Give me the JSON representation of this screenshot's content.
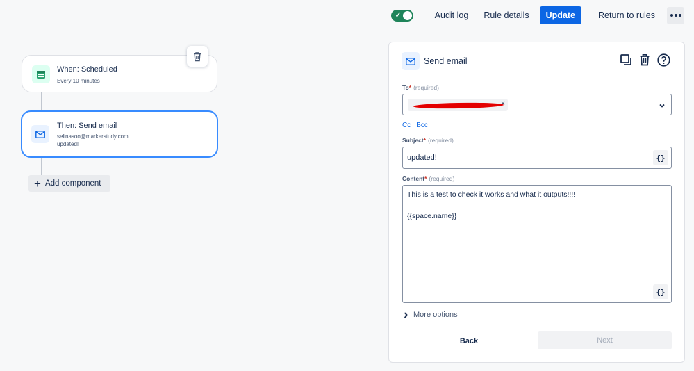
{
  "topbar": {
    "toggle_on": true,
    "audit_log": "Audit log",
    "rule_details": "Rule details",
    "update": "Update",
    "return_to_rules": "Return to rules"
  },
  "flow": {
    "trigger": {
      "title": "When: Scheduled",
      "subtitle": "Every 10 minutes",
      "icon": "calendar-icon"
    },
    "action": {
      "title": "Then: Send email",
      "line1": "selinasoo@markerstudy.com",
      "line2": "updated!",
      "icon": "mail-icon"
    },
    "add_component": "Add component"
  },
  "panel": {
    "title": "Send email",
    "to": {
      "label": "To",
      "required_mark": "*",
      "hint": "(required)",
      "chip_remove": "×"
    },
    "cc": "Cc",
    "bcc": "Bcc",
    "subject": {
      "label": "Subject",
      "required_mark": "*",
      "hint": "(required)",
      "value": "updated!"
    },
    "content": {
      "label": "Content",
      "required_mark": "*",
      "hint": "(required)",
      "line1": "This is a test to check it works and what it outputs!!!!",
      "line2": "{{space.name}}"
    },
    "smart_value_button": "{}",
    "more_options": "More options",
    "back": "Back",
    "next": "Next"
  },
  "colors": {
    "accent": "#0c66e4",
    "toggle": "#1f845a",
    "selected_border": "#388bff"
  }
}
